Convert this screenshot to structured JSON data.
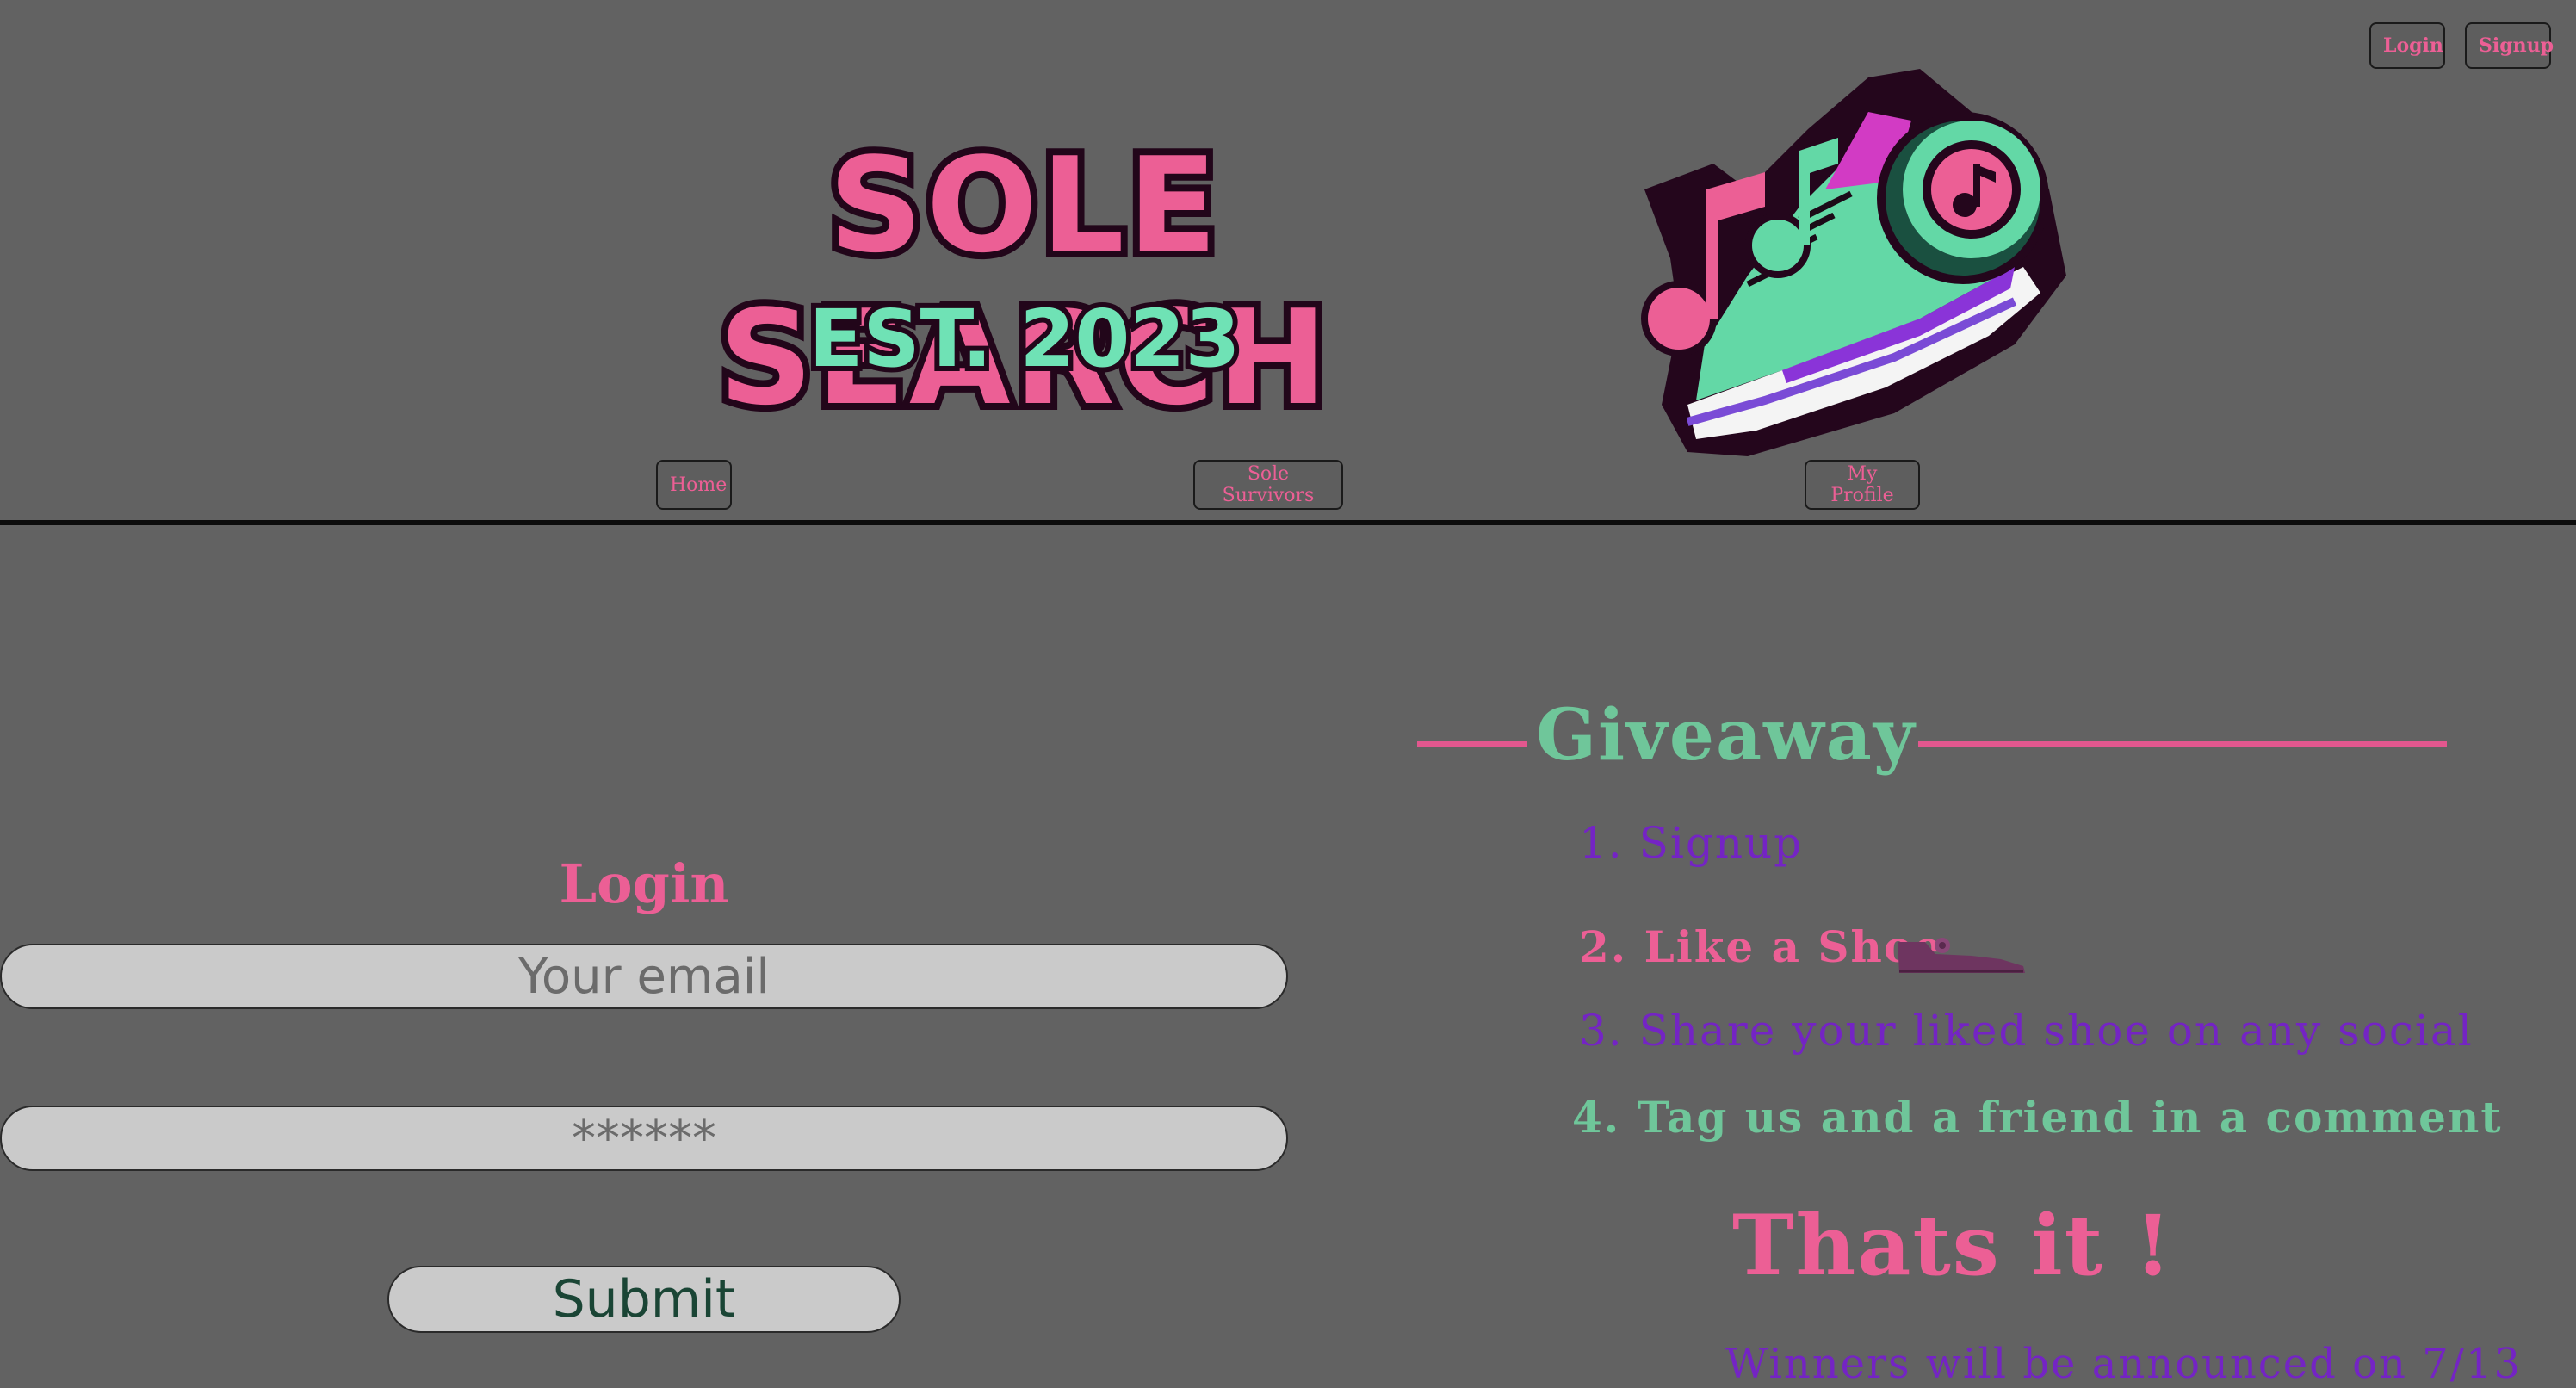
{
  "header": {
    "login_label": "Login",
    "signup_label": "Signup",
    "logo_title": "SOLE SEARCH",
    "logo_subtitle": "EST. 2023"
  },
  "nav": {
    "home_label": "Home",
    "survivors_label": "Sole Survivors",
    "profile_label": "My Profile"
  },
  "login": {
    "title": "Login",
    "email_placeholder": "Your email",
    "password_placeholder": "******",
    "submit_label": "Submit"
  },
  "giveaway": {
    "title": "Giveaway",
    "steps": [
      "1. Signup",
      "2. Like a Shoe",
      "3. Share your liked shoe on any social",
      "4. Tag us and a friend in a comment"
    ],
    "closing": "Thats it !",
    "announcement": "Winners will be announced on 7/13"
  },
  "colors": {
    "background": "#626262",
    "pink": "#ec5f95",
    "mint": "#6fc69a",
    "purple": "#7424c4"
  }
}
